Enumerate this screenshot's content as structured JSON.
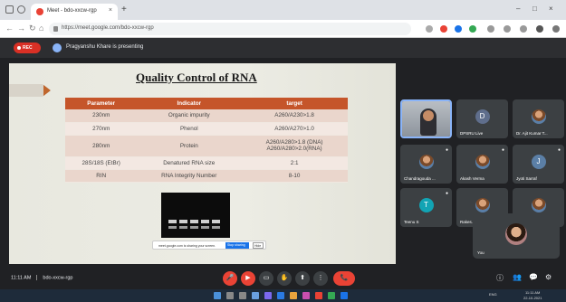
{
  "browser": {
    "tab_title": "Meet - bdo-xxcw-rgp",
    "tab_close": "×",
    "new_tab": "+",
    "url": "https://meet.google.com/bdo-xxcw-rgp",
    "window_minimize": "–",
    "window_maximize": "□",
    "window_close": "×",
    "nav_back": "←",
    "nav_forward": "→",
    "nav_reload": "↻",
    "nav_home": "⌂"
  },
  "meet": {
    "rec_label": "REC",
    "presenting_text": "Pragyanshu Khare is presenting",
    "meeting_time": "11:11 AM",
    "meeting_code": "bdo-xxcw-rgp"
  },
  "slide": {
    "title": "Quality Control of RNA",
    "table": {
      "headers": [
        "Parameter",
        "Indicator",
        "target"
      ],
      "rows": [
        [
          "230nm",
          "Organic impurity",
          "A260/A230>1.8"
        ],
        [
          "270nm",
          "Phenol",
          "A260/A270>1.0"
        ],
        [
          "280nm",
          "Protein",
          "A260/A280>1.8 (DNA)",
          "A260/A280>2.0(RNA)"
        ],
        [
          "28S/18S (EtBr)",
          "Denatured RNA size",
          "2:1"
        ],
        [
          "RIN",
          "RNA Integrity Number",
          "8-10"
        ]
      ]
    },
    "share_bar": {
      "text": "meet.google.com is sharing your screen.",
      "stop": "Stop sharing",
      "hide": "Hide"
    }
  },
  "participants": [
    {
      "name": "",
      "kind": "video"
    },
    {
      "name": "DPSRU Live",
      "initial": "D",
      "color": "#5f6e8c"
    },
    {
      "name": "Dr. Ajit Kumar T...",
      "kind": "photo"
    },
    {
      "name": "Chandragouda ...",
      "kind": "photo"
    },
    {
      "name": "Akash Verma",
      "kind": "photo"
    },
    {
      "name": "Jyoti Sarraf",
      "initial": "J",
      "color": "#5b7fa6"
    },
    {
      "name": "Teenu S",
      "initial": "T",
      "color": "#12a4b4"
    },
    {
      "name": "Rakes...",
      "kind": "photo"
    },
    {
      "name": "Dr. Vish...",
      "kind": "photo"
    }
  ],
  "self_view": {
    "name": "You"
  },
  "controls": {
    "mic": "🎤",
    "camera": "▶",
    "captions": "▭",
    "hand": "✋",
    "present": "⬆",
    "more": "⋮",
    "end": "📞",
    "info": "ⓘ",
    "people": "👥",
    "chat": "💬",
    "activities": "⚙"
  },
  "taskbar": {
    "lang": "ENG",
    "time": "11:11 AM",
    "date": "22-10-2021"
  },
  "colors": {
    "table_header": "#c5552a",
    "accent_blue": "#8ab4f8",
    "end_call": "#ea4335"
  }
}
